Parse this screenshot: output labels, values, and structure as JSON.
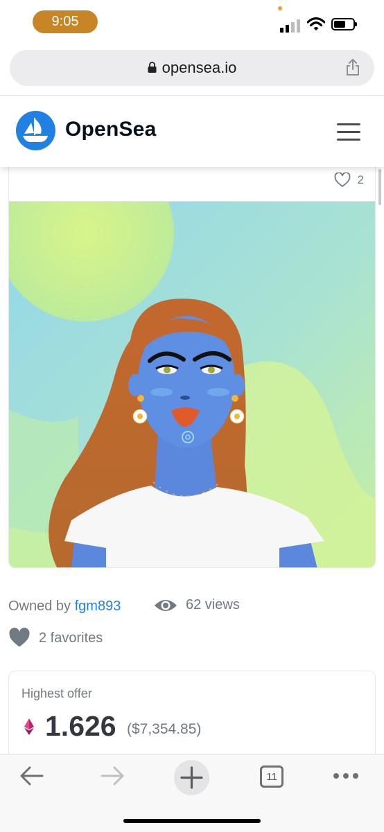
{
  "status_bar": {
    "time": "9:05",
    "accent_color": "#c88525"
  },
  "browser": {
    "url": "opensea.io",
    "tabs_count": "11"
  },
  "header": {
    "brand": "OpenSea",
    "brand_color": "#2081e2"
  },
  "item": {
    "favorite_count_top": "2",
    "owned_prefix": "Owned by",
    "owner": "fgm893",
    "views": "62 views",
    "favorites": "2 favorites"
  },
  "offer": {
    "label": "Highest offer",
    "price": "1.626",
    "usd": "($7,354.85)",
    "currency_icon": "ethereum-icon"
  },
  "icons": [
    "lock-icon",
    "share-icon",
    "opensea-logo-icon",
    "hamburger-menu-icon",
    "heart-outline-icon",
    "eye-icon",
    "heart-filled-icon",
    "back-arrow-icon",
    "forward-arrow-icon",
    "new-tab-plus-icon",
    "tabs-icon",
    "more-dots-icon"
  ]
}
